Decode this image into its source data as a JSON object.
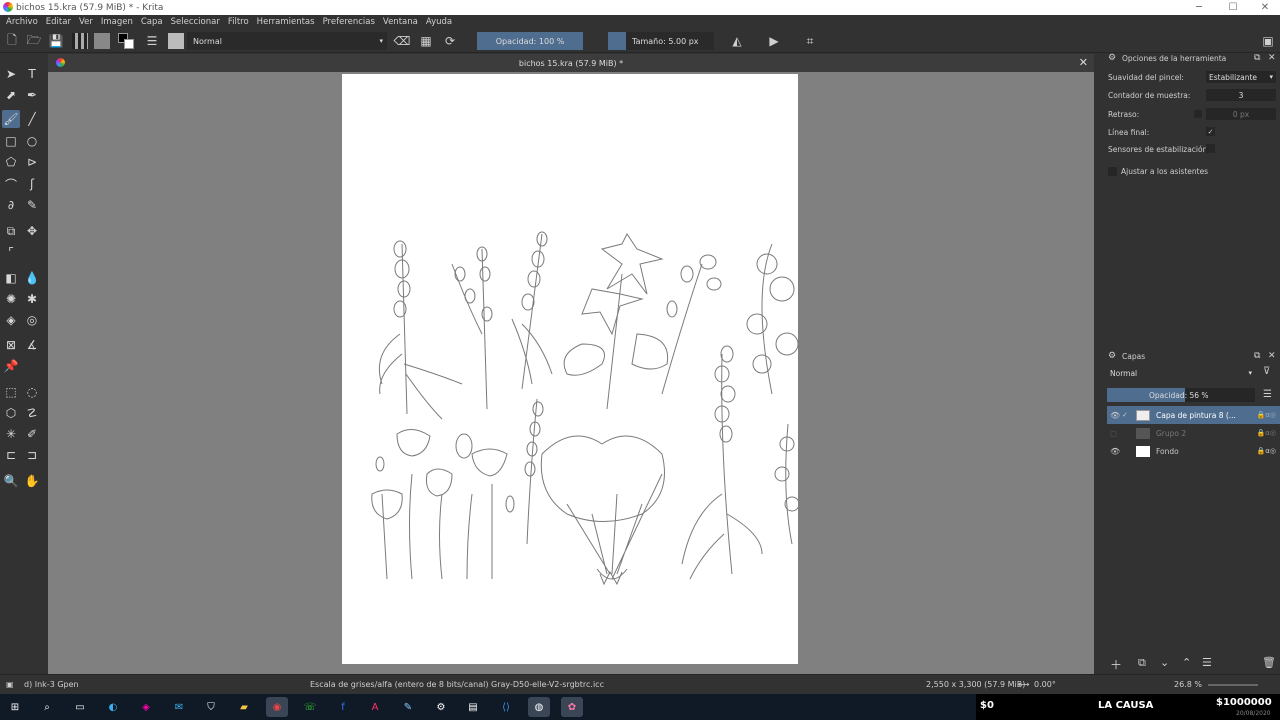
{
  "window": {
    "title": "bichos 15.kra (57.9 MiB) * - Krita",
    "minimize": "─",
    "maximize": "☐",
    "close": "✕"
  },
  "menu": [
    "Archivo",
    "Editar",
    "Ver",
    "Imagen",
    "Capa",
    "Seleccionar",
    "Filtro",
    "Herramientas",
    "Preferencias",
    "Ventana",
    "Ayuda"
  ],
  "toolbar": {
    "blend_mode": "Normal",
    "opacity": "Opacidad: 100 %",
    "size": "Tamaño: 5.00 px"
  },
  "document": {
    "tab_title": "bichos 15.kra (57.9 MiB) *"
  },
  "tool_options": {
    "title": "Opciones de la herramienta",
    "smoothing_label": "Suavidad del pincel:",
    "smoothing_value": "Estabilizante",
    "sample_label": "Contador de muestra:",
    "sample_value": "3",
    "delay_label": "Retraso:",
    "delay_value": "0 px",
    "finish_label": "Línea final:",
    "finish_checked": "✓",
    "sensors_label": "Sensores de estabilización:",
    "snap_label": "Ajustar a los asistentes"
  },
  "layers": {
    "title": "Capas",
    "blend_mode": "Normal",
    "opacity": "Opacidad:  56 %",
    "items": [
      {
        "name": "Capa de pintura 8 (...",
        "selected": true
      },
      {
        "name": "Grupo 2",
        "selected": false
      },
      {
        "name": "Fondo",
        "selected": false
      }
    ]
  },
  "status": {
    "brush": "d) Ink-3 Gpen",
    "color_profile": "Escala de grises/alfa (entero de 8 bits/canal)  Gray-D50-elle-V2-srgbtrc.icc",
    "dimensions": "2,550 x 3,300 (57.9 MiB)",
    "rotation": "0.00°",
    "zoom": "26.8 %"
  },
  "taskbar": {
    "ticker_left": "$0",
    "ticker_center": "LA CAUSA",
    "ticker_right": "$1000000",
    "date": "20/08/2020"
  },
  "colors": {
    "accent": "#4f6d8f",
    "canvas_bg": "#808080",
    "panel": "#323232",
    "taskbar": "#101a27"
  }
}
